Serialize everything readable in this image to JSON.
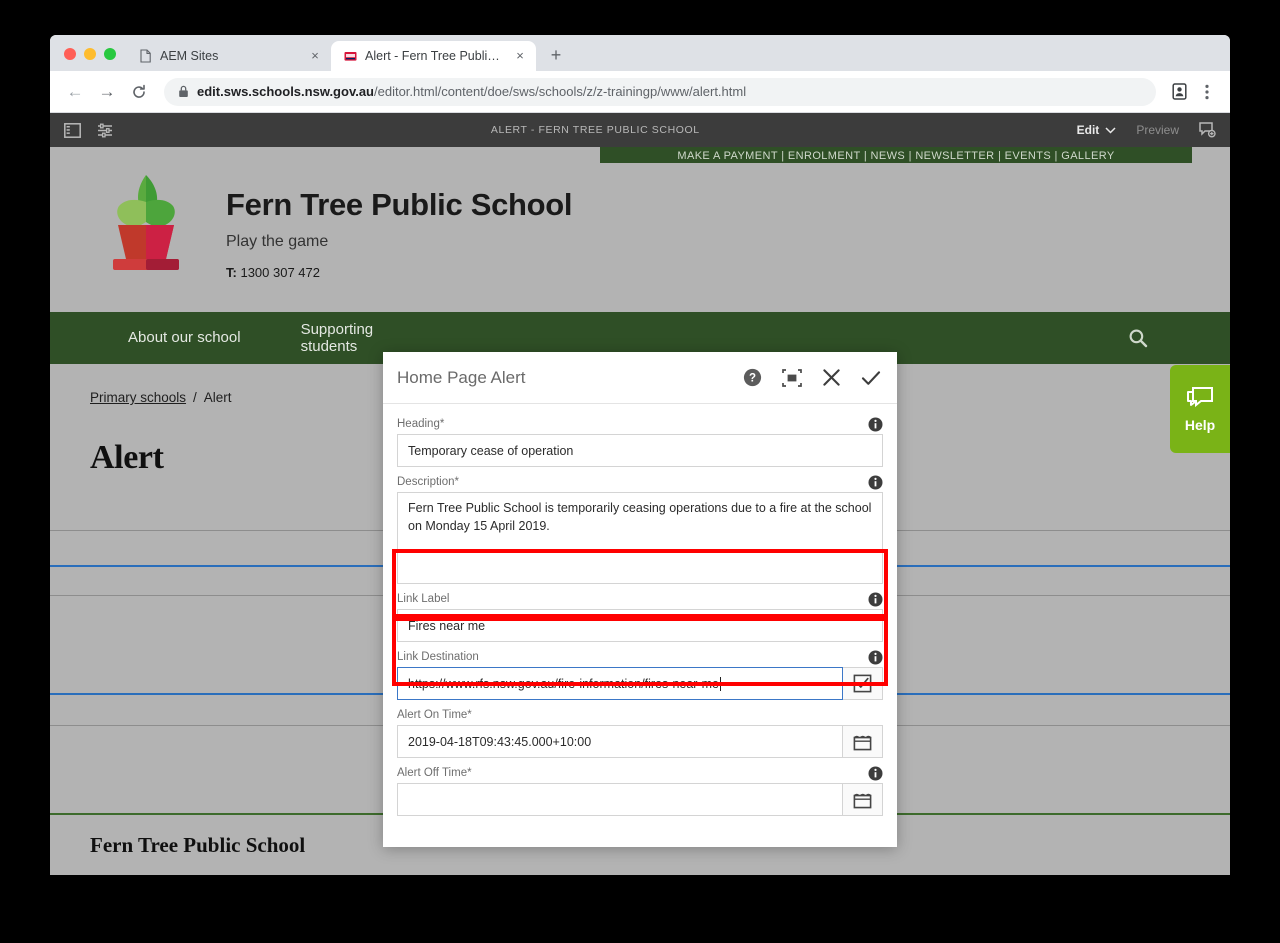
{
  "browser": {
    "tabs": [
      {
        "title": "AEM Sites",
        "favicon": "document-icon",
        "active": false
      },
      {
        "title": "Alert - Fern Tree Public School",
        "favicon": "nsw-gov-icon",
        "active": true
      }
    ],
    "new_tab_label": "+",
    "close_label": "×",
    "nav": {
      "back": "←",
      "forward": "→",
      "reload": "⟳"
    },
    "url": {
      "scheme": "https://",
      "host": "edit.sws.schools.nsw.gov.au",
      "path": "/editor.html/content/doe/sws/schools/z/z-trainingp/www/alert.html",
      "full": "https://edit.sws.schools.nsw.gov.au/editor.html/content/doe/sws/schools/z/z-trainingp/www/alert.html",
      "lock_icon": "lock-icon"
    },
    "profile_icon": "profile-icon",
    "menu_icon": "kebab-menu-icon"
  },
  "aem_toolbar": {
    "rail_toggle_icon": "side-panel-icon",
    "page_properties_icon": "sliders-icon",
    "page_title": "ALERT - FERN TREE PUBLIC SCHOOL",
    "mode_label": "Edit",
    "mode_chevron_icon": "chevron-down-icon",
    "preview_label": "Preview",
    "annotate_icon": "annotate-icon"
  },
  "site": {
    "utility_nav": "MAKE A PAYMENT  |  ENROLMENT  |  NEWS  |  NEWSLETTER  |  EVENTS  |  GALLERY",
    "logo_icon": "potted-plant-logo",
    "school_name": "Fern Tree Public School",
    "tagline": "Play the game",
    "phone_prefix": "T:",
    "phone": "1300 307 472",
    "nav_items": [
      {
        "label": "About our school"
      },
      {
        "label": "Supporting students"
      }
    ],
    "search_icon": "search-icon",
    "breadcrumb": {
      "parent": "Primary schools",
      "separator": "/",
      "current": "Alert"
    },
    "page_heading": "Alert",
    "footer_name": "Fern Tree Public School",
    "colors": {
      "nav_green": "#2f4f26",
      "guide_blue": "#2a6ebb",
      "help_green": "#7ab317"
    }
  },
  "help_tab": {
    "label": "Help",
    "icon": "chat-bubble-icon"
  },
  "dialog": {
    "title": "Home Page Alert",
    "actions": [
      {
        "name": "help-icon",
        "glyph": "?"
      },
      {
        "name": "fullscreen-icon",
        "glyph": "⬚"
      },
      {
        "name": "close-icon",
        "glyph": "✕"
      },
      {
        "name": "confirm-icon",
        "glyph": "✓"
      }
    ],
    "fields": [
      {
        "label": "Heading*",
        "value": "Temporary cease of operation",
        "info_icon": "info-icon",
        "type": "text"
      },
      {
        "label": "Description*",
        "value": "Fern Tree Public School is temporarily ceasing operations due to a fire at the school on Monday 15 April 2019.",
        "info_icon": "info-icon",
        "type": "textarea"
      },
      {
        "label": "Link Label",
        "value": "Fires near me",
        "info_icon": "info-icon",
        "type": "text",
        "highlighted": true
      },
      {
        "label": "Link Destination",
        "value": "https://www.rfs.nsw.gov.au/fire-information/fires-near-me",
        "info_icon": "info-icon",
        "type": "text",
        "focused": true,
        "highlighted": true,
        "picker_icon": "page-picker-icon"
      },
      {
        "label": "Alert On Time*",
        "value": "2019-04-18T09:43:45.000+10:00",
        "info_icon": "info-icon",
        "type": "text",
        "picker_icon": "calendar-icon"
      },
      {
        "label": "Alert Off Time*",
        "value": "",
        "info_icon": "info-icon",
        "type": "text",
        "picker_icon": "calendar-icon"
      }
    ]
  }
}
